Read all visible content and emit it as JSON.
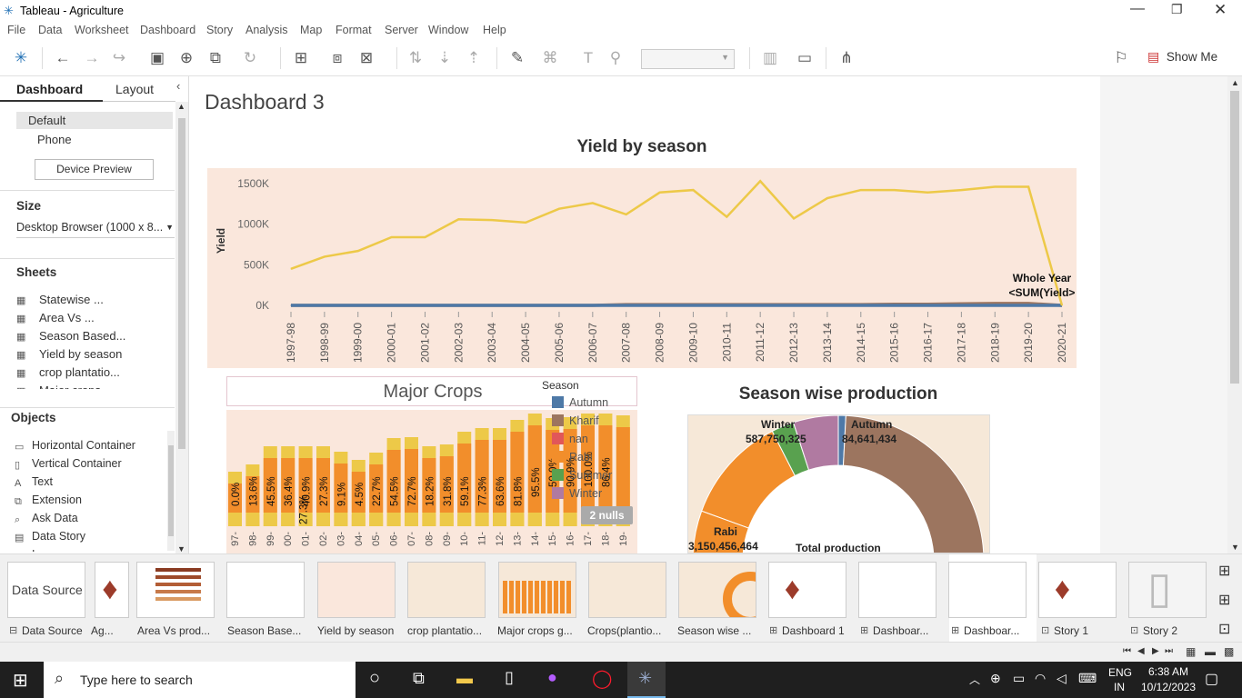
{
  "window": {
    "title": "Tableau - Agriculture"
  },
  "menu": [
    "File",
    "Data",
    "Worksheet",
    "Dashboard",
    "Story",
    "Analysis",
    "Map",
    "Format",
    "Server",
    "Window",
    "Help"
  ],
  "toolbar": {
    "show_me": "Show Me"
  },
  "left_pane": {
    "tabs": [
      "Dashboard",
      "Layout"
    ],
    "devices": [
      "Default",
      "Phone"
    ],
    "device_preview": "Device Preview",
    "size_label": "Size",
    "size_value": "Desktop Browser (1000 x 8...",
    "sheets_label": "Sheets",
    "sheets": [
      "Statewise ...",
      "Area Vs ...",
      "Season Based...",
      "Yield by season",
      "crop plantatio...",
      "Major crops ..."
    ],
    "objects_label": "Objects",
    "objects": [
      "Horizontal Container",
      "Vertical Container",
      "Text",
      "Extension",
      "Ask Data",
      "Data Story",
      "Image"
    ]
  },
  "dashboard": {
    "title": "Dashboard 3",
    "yield_chart": {
      "title": "Yield by season",
      "ylabel": "Yield",
      "annotation_line1": "Whole Year",
      "annotation_line2": "<SUM(Yield>"
    },
    "major_crops": {
      "title": "Major Crops",
      "nulls_badge": "2 nulls",
      "pct_labels": [
        "0.0%",
        "13.6%",
        "45.5%",
        "36.4%",
        "40.9%",
        "27.3%",
        "9.1%",
        "4.5%",
        "22.7%",
        "54.5%",
        "72.7%",
        "18.2%",
        "31.8%",
        "59.1%",
        "77.3%",
        "63.6%",
        "81.8%",
        "95.5%",
        "50.0%",
        "90.9%",
        "100.0%",
        "86.4%"
      ],
      "extra_label": "27.3%",
      "x_labels": [
        "97-",
        "98-",
        "99-",
        "00-",
        "01-",
        "02-",
        "03-",
        "04-",
        "05-",
        "06-",
        "07-",
        "08-",
        "09-",
        "10-",
        "11-",
        "12-",
        "13-",
        "14-",
        "15-",
        "16-",
        "17-",
        "18-",
        "19-"
      ]
    },
    "legend": {
      "title": "Season",
      "items": [
        {
          "name": "Autumn",
          "color": "#4e79a7"
        },
        {
          "name": "Kharif",
          "color": "#9c755f"
        },
        {
          "name": "nan",
          "color": "#e15759"
        },
        {
          "name": "Rabi",
          "color": "#f28e2b"
        },
        {
          "name": "Summer",
          "color": "#59a14f"
        },
        {
          "name": "Winter",
          "color": "#b07aa1"
        }
      ]
    },
    "season_production": {
      "title": "Season wise production",
      "center_label": "Total production",
      "labels": [
        {
          "season": "Winter",
          "value": "587,750,325"
        },
        {
          "season": "Autumn",
          "value": "84,641,434"
        },
        {
          "season": "Rabi",
          "value": "3,150,456,464"
        }
      ]
    }
  },
  "chart_data": [
    {
      "type": "line",
      "title": "Yield by season",
      "ylabel": "Yield",
      "ylim": [
        -100000,
        1600000
      ],
      "ytick_labels": [
        "1500K",
        "1000K",
        "500K",
        "0K"
      ],
      "categories": [
        "1997-98",
        "1998-99",
        "1999-00",
        "2000-01",
        "2001-02",
        "2002-03",
        "2003-04",
        "2004-05",
        "2005-06",
        "2006-07",
        "2007-08",
        "2008-09",
        "2009-10",
        "2010-11",
        "2011-12",
        "2012-13",
        "2013-14",
        "2014-15",
        "2015-16",
        "2016-17",
        "2017-18",
        "2018-19",
        "2019-20",
        "2020-21"
      ],
      "series": [
        {
          "name": "Whole Year",
          "color": "#edc948",
          "values": [
            450000,
            600000,
            670000,
            840000,
            840000,
            1060000,
            1050000,
            1020000,
            1190000,
            1260000,
            1120000,
            1390000,
            1420000,
            1090000,
            1530000,
            1070000,
            1320000,
            1420000,
            1420000,
            1390000,
            1420000,
            1460000,
            1460000,
            0
          ]
        },
        {
          "color": "#4e79a7",
          "values": [
            0,
            0,
            0,
            0,
            0,
            0,
            0,
            0,
            0,
            0,
            0,
            0,
            0,
            0,
            0,
            0,
            0,
            0,
            0,
            0,
            0,
            0,
            0,
            0
          ]
        },
        {
          "color": "#9c755f",
          "values": [
            0,
            0,
            0,
            0,
            0,
            0,
            0,
            0,
            0,
            0,
            10000,
            10000,
            10000,
            10000,
            10000,
            10000,
            10000,
            10000,
            15000,
            15000,
            20000,
            25000,
            25000,
            0
          ]
        }
      ]
    },
    {
      "type": "pie",
      "title": "Season wise production",
      "slices": [
        {
          "name": "Autumn",
          "value": 84641434,
          "color": "#4e79a7"
        },
        {
          "name": "Kharif",
          "color": "#9c755f"
        },
        {
          "name": "Rabi",
          "value": 3150456464,
          "color": "#f28e2b"
        },
        {
          "name": "Summer",
          "color": "#59a14f"
        },
        {
          "name": "Winter",
          "value": 587750325,
          "color": "#b07aa1"
        }
      ]
    }
  ],
  "filmstrip": {
    "tabs": [
      "Data Source",
      "Ag...",
      "Area Vs prod...",
      "Season Base...",
      "Yield by season",
      "crop plantatio...",
      "Major crops g...",
      "Crops(plantio...",
      "Season wise ...",
      "Dashboard 1",
      "Dashboar...",
      "Dashboar...",
      "Story 1",
      "Story 2"
    ],
    "thumb_data_source": "Data Source"
  },
  "taskbar": {
    "search_placeholder": "Type here to search",
    "lang1": "ENG",
    "lang2": "IN",
    "time": "6:38 AM",
    "date": "10/12/2023"
  }
}
